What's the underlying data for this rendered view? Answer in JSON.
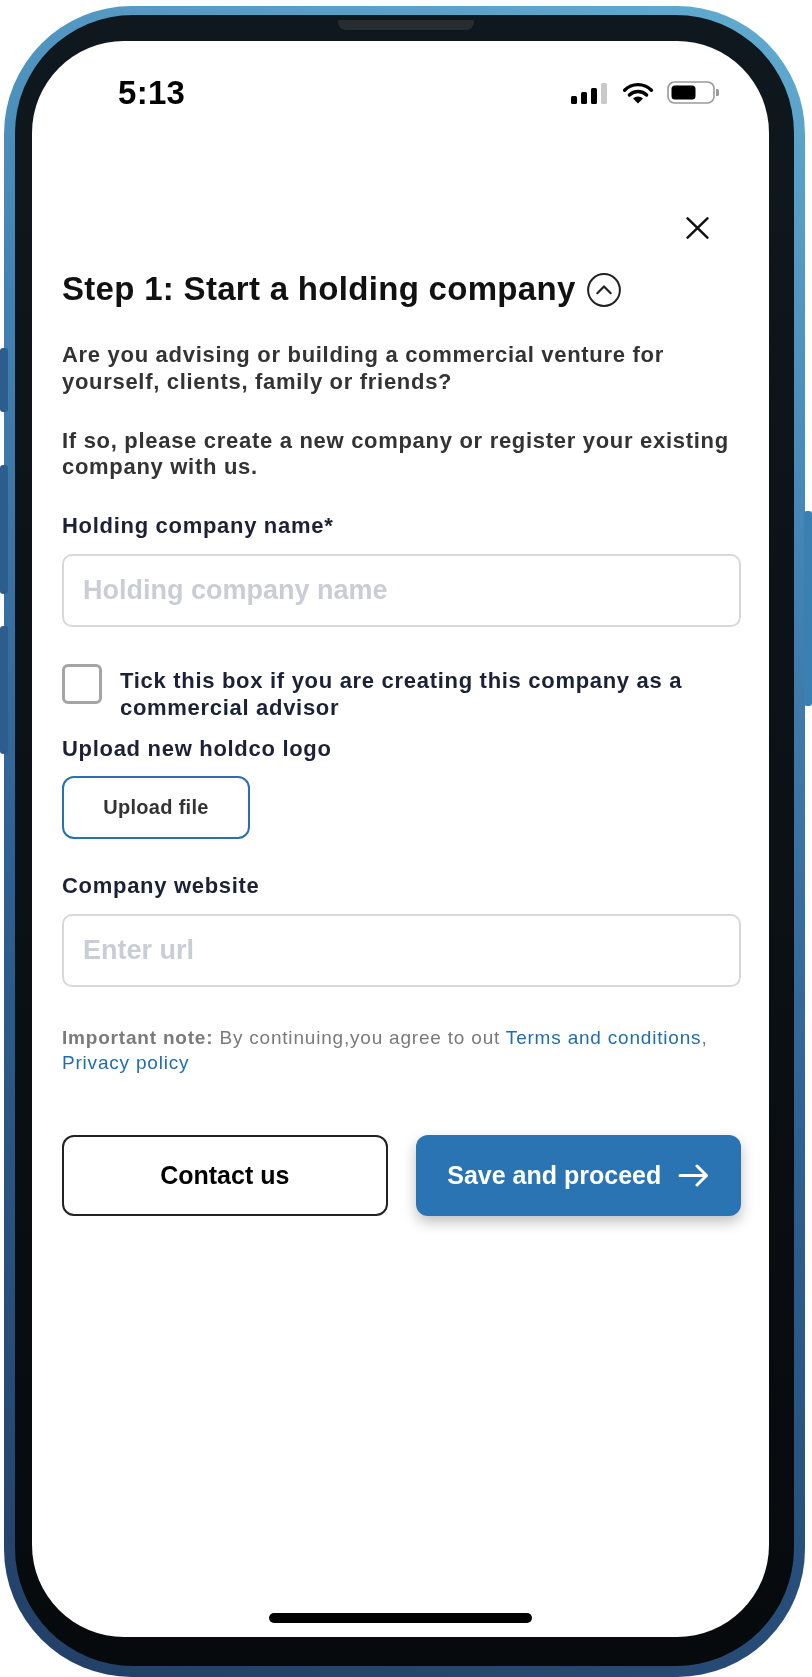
{
  "status_bar": {
    "time": "5:13"
  },
  "step": {
    "title": "Step 1: Start a holding company",
    "expanded": true
  },
  "intro": [
    "Are you advising or building a commercial venture for yourself, clients, family or friends?",
    "If so, please create a new company or register your existing company with us."
  ],
  "form": [
    {
      "kind": "text",
      "label": "Holding company name*",
      "placeholder": "Holding company name"
    },
    {
      "kind": "checkbox",
      "label": "Tick this box if you are creating this company as a commercial advisor",
      "checked": false
    },
    {
      "kind": "upload",
      "label": "Upload new holdco logo",
      "button": "Upload file"
    },
    {
      "kind": "text",
      "label": "Company website",
      "placeholder": "Enter url"
    }
  ],
  "note": [
    {
      "kind": "bold",
      "text": "Important note:"
    },
    {
      "kind": "text",
      "text": " By continuing,you agree to out "
    },
    {
      "kind": "link",
      "text": "Terms and conditions"
    },
    {
      "kind": "text",
      "text": ", "
    },
    {
      "kind": "link",
      "text": "Privacy policy"
    }
  ],
  "actions": [
    {
      "kind": "secondary",
      "label": "Contact us"
    },
    {
      "kind": "primary",
      "label": "Save and proceed"
    }
  ]
}
